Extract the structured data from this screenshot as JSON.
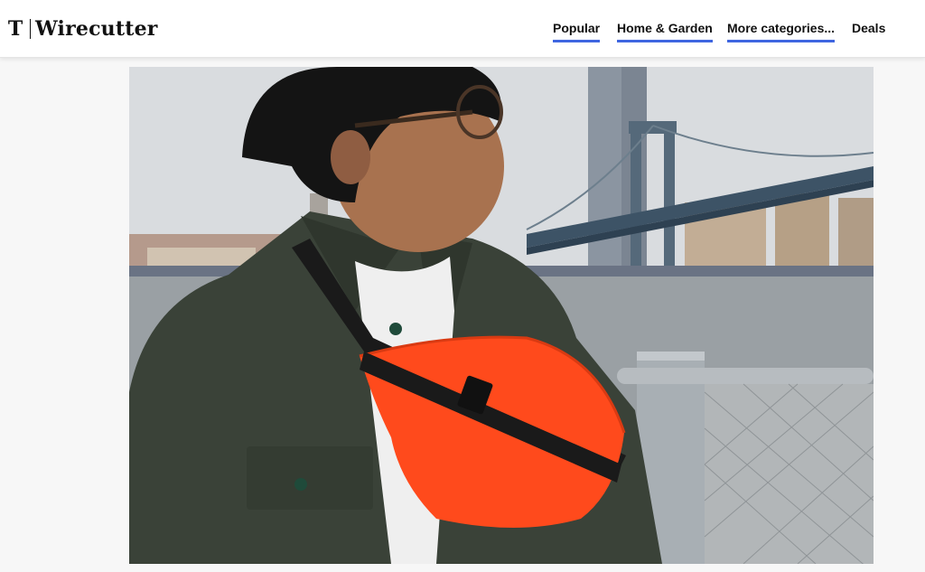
{
  "header": {
    "logo_mark": "T",
    "logo_text": "Wirecutter"
  },
  "nav": {
    "items": [
      {
        "label": "Popular",
        "underlined": true
      },
      {
        "label": "Home & Garden",
        "underlined": true
      },
      {
        "label": "More categories...",
        "underlined": true
      },
      {
        "label": "Deals",
        "underlined": false
      }
    ]
  },
  "colors": {
    "nav_underline": "#3f66e0",
    "bag": "#ff4a1c",
    "jacket": "#3a4238"
  }
}
